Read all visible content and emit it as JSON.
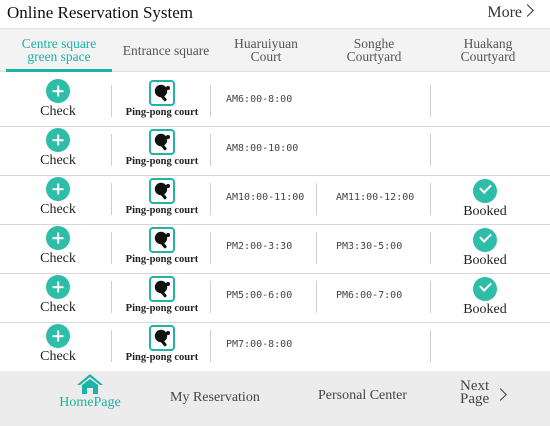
{
  "header": {
    "title": "Online Reservation System",
    "more_label": "More"
  },
  "tabs": [
    {
      "line1": "Centre square",
      "line2": "green space",
      "active": true
    },
    {
      "line1": "Entrance square",
      "line2": ""
    },
    {
      "line1": "Huaruiyuan",
      "line2": "Court"
    },
    {
      "line1": "Songhe",
      "line2": "Courtyard"
    },
    {
      "line1": "Huakang",
      "line2": "Courtyard"
    }
  ],
  "rows": [
    {
      "action": "Check",
      "court": "Ping-pong court",
      "slot1": "AM6:00-8:00",
      "slot2": "",
      "status": ""
    },
    {
      "action": "Check",
      "court": "Ping-pong court",
      "slot1": "AM8:00-10:00",
      "slot2": "",
      "status": ""
    },
    {
      "action": "Check",
      "court": "Ping-pong court",
      "slot1": "AM10:00-11:00",
      "slot2": "AM11:00-12:00",
      "status": "Booked"
    },
    {
      "action": "Check",
      "court": "Ping-pong court",
      "slot1": "PM2:00-3:30",
      "slot2": "PM3:30-5:00",
      "status": "Booked"
    },
    {
      "action": "Check",
      "court": "Ping-pong court",
      "slot1": "PM5:00-6:00",
      "slot2": "PM6:00-7:00",
      "status": "Booked"
    },
    {
      "action": "Check",
      "court": "Ping-pong court",
      "slot1": "PM7:00-8:00",
      "slot2": "",
      "status": ""
    }
  ],
  "footer": {
    "home": "HomePage",
    "reservation": "My Reservation",
    "personal": "Personal Center",
    "next_line1": "Next",
    "next_line2": "Page"
  },
  "colors": {
    "accent": "#1ab3a6",
    "button": "#2ebda8"
  },
  "icons": {
    "more": "chevron-right-icon",
    "check": "plus-circle-icon",
    "court": "ping-pong-icon",
    "booked": "check-circle-icon",
    "home": "home-icon",
    "next": "chevron-right-icon"
  }
}
